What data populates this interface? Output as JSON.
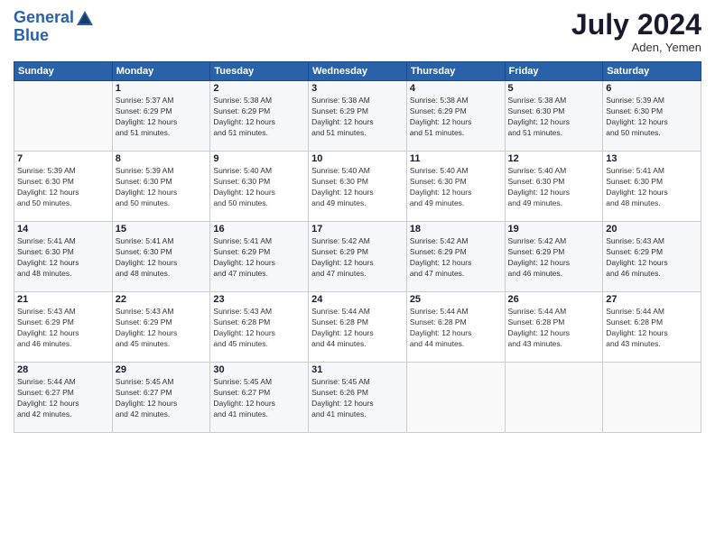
{
  "header": {
    "logo_line1": "General",
    "logo_line2": "Blue",
    "month_year": "July 2024",
    "location": "Aden, Yemen"
  },
  "days_of_week": [
    "Sunday",
    "Monday",
    "Tuesday",
    "Wednesday",
    "Thursday",
    "Friday",
    "Saturday"
  ],
  "weeks": [
    [
      {
        "day": "",
        "info": ""
      },
      {
        "day": "1",
        "info": "Sunrise: 5:37 AM\nSunset: 6:29 PM\nDaylight: 12 hours\nand 51 minutes."
      },
      {
        "day": "2",
        "info": "Sunrise: 5:38 AM\nSunset: 6:29 PM\nDaylight: 12 hours\nand 51 minutes."
      },
      {
        "day": "3",
        "info": "Sunrise: 5:38 AM\nSunset: 6:29 PM\nDaylight: 12 hours\nand 51 minutes."
      },
      {
        "day": "4",
        "info": "Sunrise: 5:38 AM\nSunset: 6:29 PM\nDaylight: 12 hours\nand 51 minutes."
      },
      {
        "day": "5",
        "info": "Sunrise: 5:38 AM\nSunset: 6:30 PM\nDaylight: 12 hours\nand 51 minutes."
      },
      {
        "day": "6",
        "info": "Sunrise: 5:39 AM\nSunset: 6:30 PM\nDaylight: 12 hours\nand 50 minutes."
      }
    ],
    [
      {
        "day": "7",
        "info": "Sunrise: 5:39 AM\nSunset: 6:30 PM\nDaylight: 12 hours\nand 50 minutes."
      },
      {
        "day": "8",
        "info": "Sunrise: 5:39 AM\nSunset: 6:30 PM\nDaylight: 12 hours\nand 50 minutes."
      },
      {
        "day": "9",
        "info": "Sunrise: 5:40 AM\nSunset: 6:30 PM\nDaylight: 12 hours\nand 50 minutes."
      },
      {
        "day": "10",
        "info": "Sunrise: 5:40 AM\nSunset: 6:30 PM\nDaylight: 12 hours\nand 49 minutes."
      },
      {
        "day": "11",
        "info": "Sunrise: 5:40 AM\nSunset: 6:30 PM\nDaylight: 12 hours\nand 49 minutes."
      },
      {
        "day": "12",
        "info": "Sunrise: 5:40 AM\nSunset: 6:30 PM\nDaylight: 12 hours\nand 49 minutes."
      },
      {
        "day": "13",
        "info": "Sunrise: 5:41 AM\nSunset: 6:30 PM\nDaylight: 12 hours\nand 48 minutes."
      }
    ],
    [
      {
        "day": "14",
        "info": "Sunrise: 5:41 AM\nSunset: 6:30 PM\nDaylight: 12 hours\nand 48 minutes."
      },
      {
        "day": "15",
        "info": "Sunrise: 5:41 AM\nSunset: 6:30 PM\nDaylight: 12 hours\nand 48 minutes."
      },
      {
        "day": "16",
        "info": "Sunrise: 5:41 AM\nSunset: 6:29 PM\nDaylight: 12 hours\nand 47 minutes."
      },
      {
        "day": "17",
        "info": "Sunrise: 5:42 AM\nSunset: 6:29 PM\nDaylight: 12 hours\nand 47 minutes."
      },
      {
        "day": "18",
        "info": "Sunrise: 5:42 AM\nSunset: 6:29 PM\nDaylight: 12 hours\nand 47 minutes."
      },
      {
        "day": "19",
        "info": "Sunrise: 5:42 AM\nSunset: 6:29 PM\nDaylight: 12 hours\nand 46 minutes."
      },
      {
        "day": "20",
        "info": "Sunrise: 5:43 AM\nSunset: 6:29 PM\nDaylight: 12 hours\nand 46 minutes."
      }
    ],
    [
      {
        "day": "21",
        "info": "Sunrise: 5:43 AM\nSunset: 6:29 PM\nDaylight: 12 hours\nand 46 minutes."
      },
      {
        "day": "22",
        "info": "Sunrise: 5:43 AM\nSunset: 6:29 PM\nDaylight: 12 hours\nand 45 minutes."
      },
      {
        "day": "23",
        "info": "Sunrise: 5:43 AM\nSunset: 6:28 PM\nDaylight: 12 hours\nand 45 minutes."
      },
      {
        "day": "24",
        "info": "Sunrise: 5:44 AM\nSunset: 6:28 PM\nDaylight: 12 hours\nand 44 minutes."
      },
      {
        "day": "25",
        "info": "Sunrise: 5:44 AM\nSunset: 6:28 PM\nDaylight: 12 hours\nand 44 minutes."
      },
      {
        "day": "26",
        "info": "Sunrise: 5:44 AM\nSunset: 6:28 PM\nDaylight: 12 hours\nand 43 minutes."
      },
      {
        "day": "27",
        "info": "Sunrise: 5:44 AM\nSunset: 6:28 PM\nDaylight: 12 hours\nand 43 minutes."
      }
    ],
    [
      {
        "day": "28",
        "info": "Sunrise: 5:44 AM\nSunset: 6:27 PM\nDaylight: 12 hours\nand 42 minutes."
      },
      {
        "day": "29",
        "info": "Sunrise: 5:45 AM\nSunset: 6:27 PM\nDaylight: 12 hours\nand 42 minutes."
      },
      {
        "day": "30",
        "info": "Sunrise: 5:45 AM\nSunset: 6:27 PM\nDaylight: 12 hours\nand 41 minutes."
      },
      {
        "day": "31",
        "info": "Sunrise: 5:45 AM\nSunset: 6:26 PM\nDaylight: 12 hours\nand 41 minutes."
      },
      {
        "day": "",
        "info": ""
      },
      {
        "day": "",
        "info": ""
      },
      {
        "day": "",
        "info": ""
      }
    ]
  ]
}
